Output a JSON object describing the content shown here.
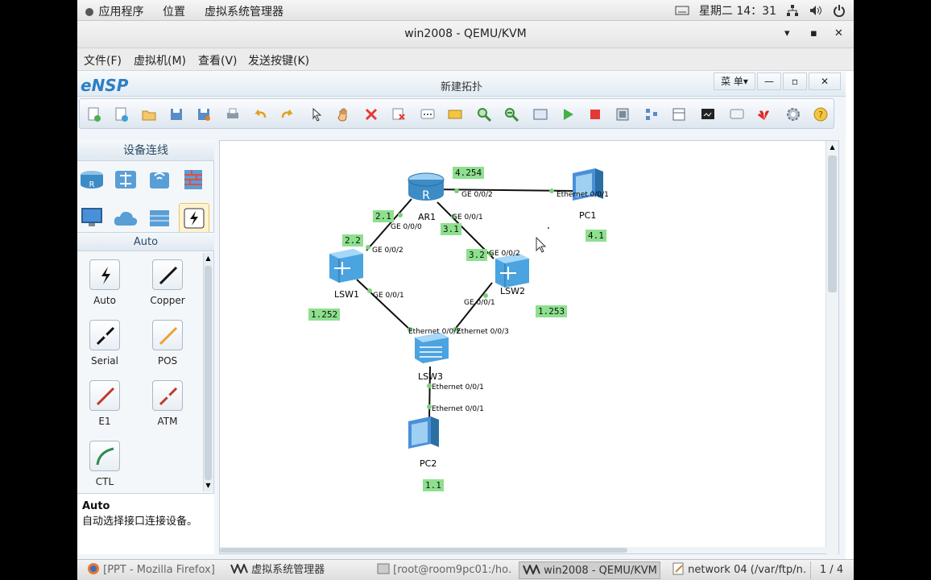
{
  "top_bar": {
    "applications": "应用程序",
    "places": "位置",
    "vm_manager": "虚拟系统管理器",
    "clock": "星期二 14：31"
  },
  "qemu": {
    "title": "win2008 - QEMU/KVM",
    "menu": [
      "文件(F)",
      "虚拟机(M)",
      "查看(V)",
      "发送按键(K)"
    ]
  },
  "ensp": {
    "logo": "eNSP",
    "title": "新建拓扑",
    "menu_button": "菜 单▾",
    "panel_title": "设备连线",
    "sub_title": "Auto",
    "cables": [
      {
        "label": "Auto",
        "color": "#1a1a1a"
      },
      {
        "label": "Copper",
        "color": "#1a1a1a"
      },
      {
        "label": "Serial",
        "color": "#1a1a1a"
      },
      {
        "label": "POS",
        "color": "#f0a030"
      },
      {
        "label": "E1",
        "color": "#c0392b"
      },
      {
        "label": "ATM",
        "color": "#c0392b"
      },
      {
        "label": "CTL",
        "color": "#2e8b57"
      }
    ],
    "desc_title": "Auto",
    "desc_text": "自动选择接口连接设备。"
  },
  "topology": {
    "devices": [
      {
        "id": "ar1",
        "name": "AR1",
        "kind": "router"
      },
      {
        "id": "pc1",
        "name": "PC1",
        "kind": "pc"
      },
      {
        "id": "lsw1",
        "name": "LSW1",
        "kind": "switch"
      },
      {
        "id": "lsw2",
        "name": "LSW2",
        "kind": "switch"
      },
      {
        "id": "lsw3",
        "name": "LSW3",
        "kind": "switch2"
      },
      {
        "id": "pc2",
        "name": "PC2",
        "kind": "pc"
      }
    ],
    "port_labels": [
      "GE 0/0/2",
      "Ethernet 0/0/1",
      "GE 0/0/1",
      "GE 0/0/0",
      "GE 0/0/2",
      "GE 0/0/2",
      "GE 0/0/1",
      "GE 0/0/1",
      "Ethernet 0/0/2",
      "Ethernet 0/0/3",
      "Ethernet 0/0/1",
      "Ethernet 0/0/1"
    ],
    "ip_notes": [
      "4.254",
      "4.1",
      "2.1",
      "2.2",
      "3.1",
      "3.2",
      "1.252",
      "1.253",
      "1.1"
    ],
    "note_color": "#8ee08e"
  },
  "taskbar": {
    "items": [
      "[PPT - Mozilla Firefox]",
      "虚拟系统管理器",
      "[root@room9pc01:/ho…",
      "win2008 - QEMU/KVM",
      "network 04 (/var/ftp/n…"
    ],
    "pager": "1 / 4"
  }
}
